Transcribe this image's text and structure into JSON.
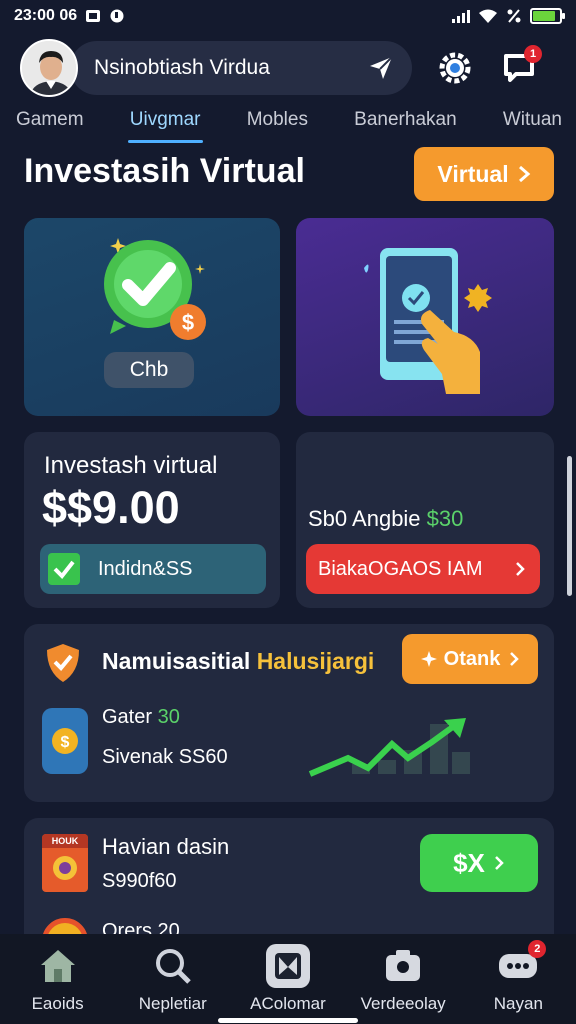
{
  "status_bar": {
    "time": "23:00 06"
  },
  "header": {
    "title": "Nsinobtiash Virdua",
    "notification_count": "1"
  },
  "tabs": [
    {
      "label": "Gamem",
      "active": false
    },
    {
      "label": "Uivgmar",
      "active": true
    },
    {
      "label": "Mobles",
      "active": false
    },
    {
      "label": "Banerhakan",
      "active": false
    },
    {
      "label": "Wituan",
      "active": false
    }
  ],
  "section": {
    "title": "Investasih Virtual",
    "button_label": "Virtual"
  },
  "card_chb": {
    "chip_label": "Chb"
  },
  "balance_card": {
    "label": "Investash virtual",
    "amount": "$$9.00",
    "bar_label": "Indidn&SS"
  },
  "angbie_card": {
    "text_white": "Sb0 Angbie",
    "text_green": "$30",
    "bar_label": "BiakaOGAOS IAM"
  },
  "promo_card": {
    "title_white": "Namuisasitial",
    "title_yellow": "Halusijargi",
    "button_label": "Otank",
    "line1_white": "Gater",
    "line1_green": "30",
    "line2": "Sivenak SS60"
  },
  "bottom_card": {
    "badge_label": "HOUK",
    "title": "Havian dasin",
    "subtitle": "S990f60",
    "partial_text": "Orers 20",
    "button_label": "$X"
  },
  "bottom_nav": [
    {
      "label": "Eaoids",
      "icon": "home-icon"
    },
    {
      "label": "Nepletiar",
      "icon": "search-icon"
    },
    {
      "label": "AColomar",
      "icon": "app-icon"
    },
    {
      "label": "Verdeeolay",
      "icon": "camera-icon"
    },
    {
      "label": "Nayan",
      "icon": "chat-icon",
      "badge": "2"
    }
  ],
  "colors": {
    "background": "#141a2e",
    "accent_orange": "#f59a2d",
    "accent_green": "#39c34d",
    "accent_red": "#e53935",
    "tab_active": "#4fb0ff"
  }
}
